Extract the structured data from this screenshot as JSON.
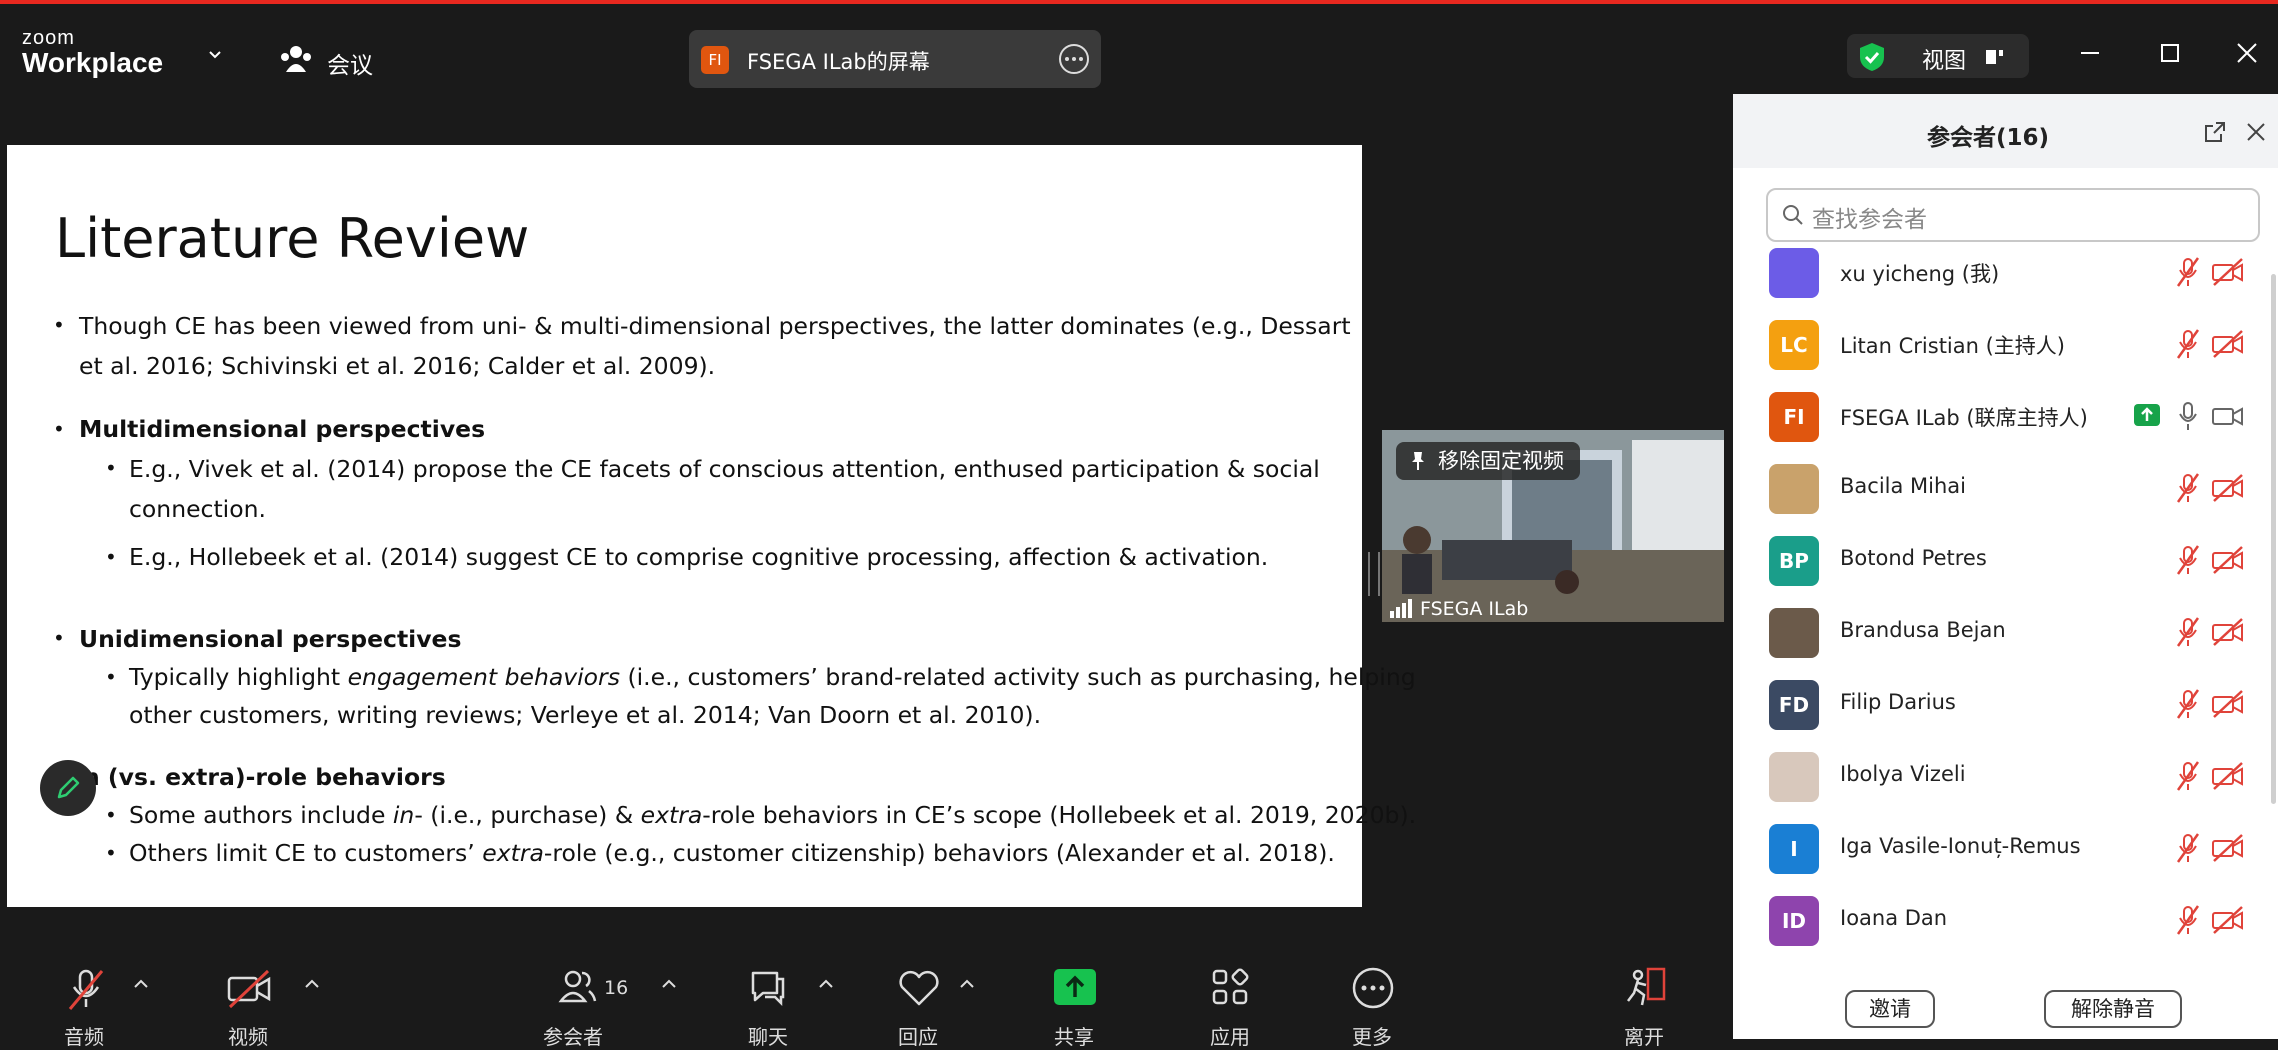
{
  "app": {
    "brand_line1": "zoom",
    "brand_line2": "Workplace",
    "meeting_label": "会议",
    "share_badge": "FI",
    "share_title": "FSEGA ILab的屏幕",
    "view_label": "视图"
  },
  "slide": {
    "title": "Literature Review",
    "l1": "Though CE has been viewed from uni- & multi-dimensional perspectives, the latter dominates (e.g., Dessart",
    "l2": "et al. 2016; Schivinski et al. 2016; Calder et al. 2009).",
    "h1": "Multidimensional perspectives",
    "l3": "E.g., Vivek et al. (2014) propose the CE facets of conscious attention, enthused participation & social",
    "l4": "connection.",
    "l5": "E.g., Hollebeek et al. (2014) suggest CE to comprise cognitive processing, affection & activation.",
    "h2": "Unidimensional perspectives",
    "l6a": "Typically highlight ",
    "l6b": "engagement behaviors",
    "l6c": " (i.e., customers’ brand-related activity such as purchasing, helping",
    "l7": "other customers, writing reviews; Verleye et al. 2014; Van Doorn et al. 2010).",
    "h3": "n (vs. extra)-role behaviors",
    "l8a": "Some authors include ",
    "l8b": "in",
    "l8c": "- (i.e., purchase) & ",
    "l8d": "extra",
    "l8e": "-role behaviors in CE’s scope (Hollebeek et al. 2019, 2020b).",
    "l9a": "Others limit CE to customers’ ",
    "l9b": "extra",
    "l9c": "-role (e.g., customer citizenship) behaviors (Alexander et al. 2018)."
  },
  "video": {
    "pin_tooltip": "移除固定视频",
    "name": "FSEGA ILab"
  },
  "panel": {
    "title": "参会者(16)",
    "search_placeholder": "查找参会者",
    "participants": [
      {
        "initials": "",
        "name": "xu yicheng (我)",
        "color": "#6c5ce7"
      },
      {
        "initials": "LC",
        "name": "Litan Cristian (主持人)",
        "color": "#f4a010"
      },
      {
        "initials": "FI",
        "name": "FSEGA ILab (联席主持人)",
        "color": "#e0560f"
      },
      {
        "initials": "",
        "name": "Bacila Mihai",
        "color": "#c9a26b"
      },
      {
        "initials": "BP",
        "name": "Botond Petres",
        "color": "#1a9e8a"
      },
      {
        "initials": "",
        "name": "Brandusa Bejan",
        "color": "#6b5a4a"
      },
      {
        "initials": "FD",
        "name": "Filip Darius",
        "color": "#3b4a63"
      },
      {
        "initials": "",
        "name": "Ibolya Vizeli",
        "color": "#d8c8bc"
      },
      {
        "initials": "I",
        "name": "Iga Vasile-Ionuț-Remus",
        "color": "#1a7fd4"
      },
      {
        "initials": "ID",
        "name": "Ioana Dan",
        "color": "#8e44ad"
      }
    ],
    "invite_label": "邀请",
    "unmute_label": "解除静音"
  },
  "toolbar": {
    "audio": "音频",
    "video": "视频",
    "participants": "参会者",
    "participants_count": "16",
    "chat": "聊天",
    "react": "回应",
    "share": "共享",
    "apps": "应用",
    "more": "更多",
    "leave": "离开"
  },
  "colors": {
    "accent_red": "#e8281f",
    "share_green": "#17c24f",
    "muted_red": "#e0433a"
  }
}
